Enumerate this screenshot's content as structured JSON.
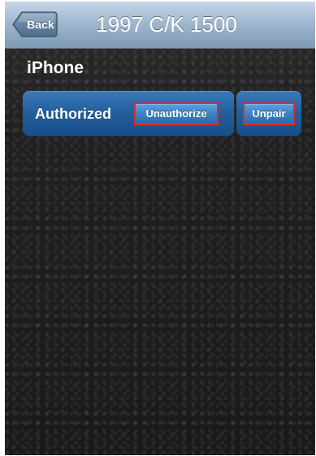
{
  "navigation": {
    "back_label": "Back",
    "title": "1997 C/K 1500"
  },
  "device": {
    "name": "iPhone",
    "status": "Authorized",
    "actions": {
      "unauthorize_label": "Unauthorize",
      "unpair_label": "Unpair"
    }
  },
  "colors": {
    "nav_gradient_top": "#c7d7e7",
    "nav_gradient_bottom": "#7f99b3",
    "card_blue": "#225f9e",
    "button_blue": "#3d83c6",
    "highlight_red": "#e22a2a",
    "background_dark": "#202020"
  },
  "icons": {
    "back_icon": "back-arrow-icon"
  }
}
